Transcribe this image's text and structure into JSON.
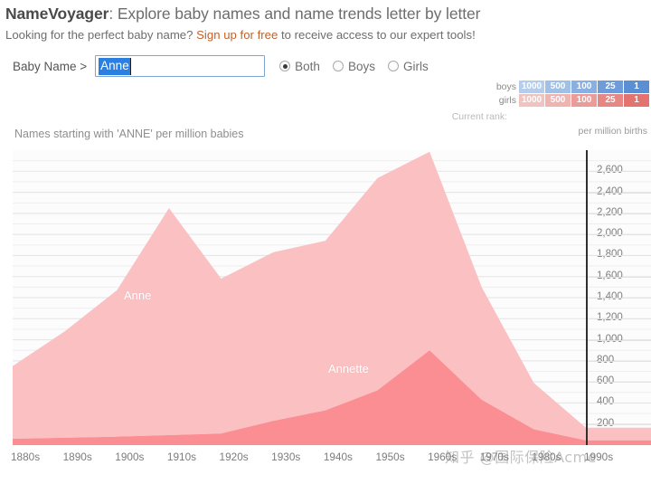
{
  "header": {
    "title_brand": "NameVoyager",
    "title_rest": ": Explore baby names and name trends letter by letter",
    "subtitle_before": "Looking for the perfect baby name? ",
    "subtitle_link": "Sign up for free",
    "subtitle_after": " to receive access to our expert tools!"
  },
  "search": {
    "label": "Baby Name >",
    "value": "Anne",
    "placeholder": "",
    "gender_options": [
      {
        "label": "Both",
        "selected": true
      },
      {
        "label": "Boys",
        "selected": false
      },
      {
        "label": "Girls",
        "selected": false
      }
    ]
  },
  "rank_legend": {
    "current_rank_label": "Current rank:",
    "per_million_label": "per million births",
    "rows": [
      {
        "name": "boys",
        "cells": [
          {
            "value": "1000",
            "color": "#b5cdec"
          },
          {
            "value": "500",
            "color": "#a0c0e6"
          },
          {
            "value": "100",
            "color": "#89b0e0"
          },
          {
            "value": "25",
            "color": "#6e9cd8"
          },
          {
            "value": "1",
            "color": "#5b8fd4"
          }
        ]
      },
      {
        "name": "girls",
        "cells": [
          {
            "value": "1000",
            "color": "#f0c3c0"
          },
          {
            "value": "500",
            "color": "#efb3b0"
          },
          {
            "value": "100",
            "color": "#eb9b98"
          },
          {
            "value": "25",
            "color": "#e78783"
          },
          {
            "value": "1",
            "color": "#e2736f"
          }
        ]
      }
    ]
  },
  "chart_title": "Names starting with 'ANNE' per million babies",
  "watermark": "知乎 @国际保险Acme",
  "colors": {
    "anne_band": "#fbc0c2",
    "annette_band": "#fa8e92",
    "chart_bg": "#fcfcfd",
    "gridline": "#e3e3e6",
    "link": "#c0622c",
    "axis": "#2f2f2f"
  },
  "chart_data": {
    "type": "area",
    "title": "Names starting with 'ANNE' per million babies",
    "xlabel": "",
    "ylabel": "per million births",
    "stacked": true,
    "grid": true,
    "legend": "inline-band-labels",
    "ylim": [
      0,
      2800
    ],
    "yticks": [
      200,
      400,
      600,
      800,
      1000,
      1200,
      1400,
      1600,
      1800,
      2000,
      2200,
      2400,
      2600
    ],
    "ytick_labels": [
      "200",
      "400",
      "600",
      "800",
      "1,000",
      "1,200",
      "1,400",
      "1,600",
      "1,800",
      "2,000",
      "2,200",
      "2,400",
      "2,600"
    ],
    "categories": [
      "1880s",
      "1890s",
      "1900s",
      "1910s",
      "1920s",
      "1930s",
      "1940s",
      "1950s",
      "1960s",
      "1970s",
      "1980s",
      "1990s"
    ],
    "series": [
      {
        "name": "Annette",
        "color": "#fa8e92",
        "values": [
          60,
          70,
          80,
          95,
          110,
          230,
          330,
          520,
          900,
          430,
          150,
          45
        ]
      },
      {
        "name": "Anne",
        "color": "#fbc0c2",
        "values": [
          690,
          1010,
          1390,
          2155,
          1470,
          1600,
          1610,
          2015,
          1885,
          1070,
          440,
          120
        ]
      }
    ],
    "totals": [
      750,
      1080,
      1470,
      2250,
      1580,
      1830,
      1940,
      2535,
      2785,
      1500,
      590,
      165
    ]
  }
}
